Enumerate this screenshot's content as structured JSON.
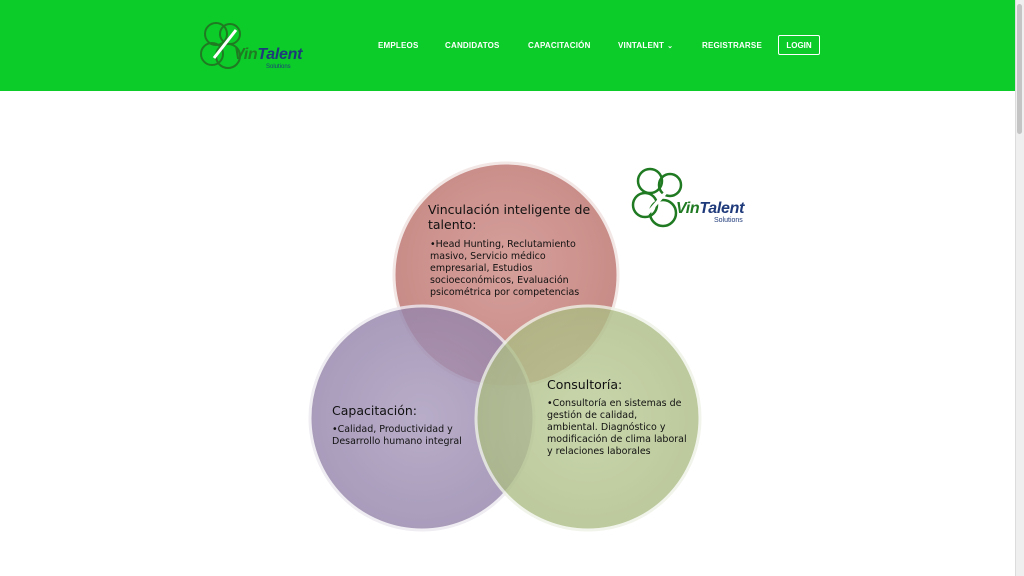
{
  "header": {
    "brand": {
      "name_part1": "Vin",
      "name_part2": "Talent",
      "sub": "Solutions"
    },
    "nav": [
      {
        "label": "EMPLEOS"
      },
      {
        "label": "CANDIDATOS"
      },
      {
        "label": "CAPACITACIÓN"
      },
      {
        "label": "VINTALENT"
      },
      {
        "label": "REGISTRARSE"
      }
    ],
    "login_label": "LOGIN"
  },
  "content_logo": {
    "name_part1": "Vin",
    "name_part2": "Talent",
    "sub": "Solutions"
  },
  "venn": {
    "top": {
      "title": "Vinculación inteligente de talento:",
      "body": "•Head Hunting, Reclutamiento masivo,  Servicio médico empresarial, Estudios socioeconómicos, Evaluación psicométrica por competencias"
    },
    "left": {
      "title": "Capacitación:",
      "body": "•Calidad, Productividad y Desarrollo humano integral"
    },
    "right": {
      "title": "Consultoría:",
      "body": "•Consultoría en sistemas de gestión de calidad, ambiental. Diagnóstico y modificación de clima laboral y relaciones laborales"
    },
    "colors": {
      "top": "#c98a86",
      "left": "#9f8fb3",
      "right": "#b3c48e"
    }
  },
  "colors": {
    "header_bg": "#0ccc2a",
    "logo_green": "#1f7a22",
    "logo_blue": "#1f3a7a"
  }
}
